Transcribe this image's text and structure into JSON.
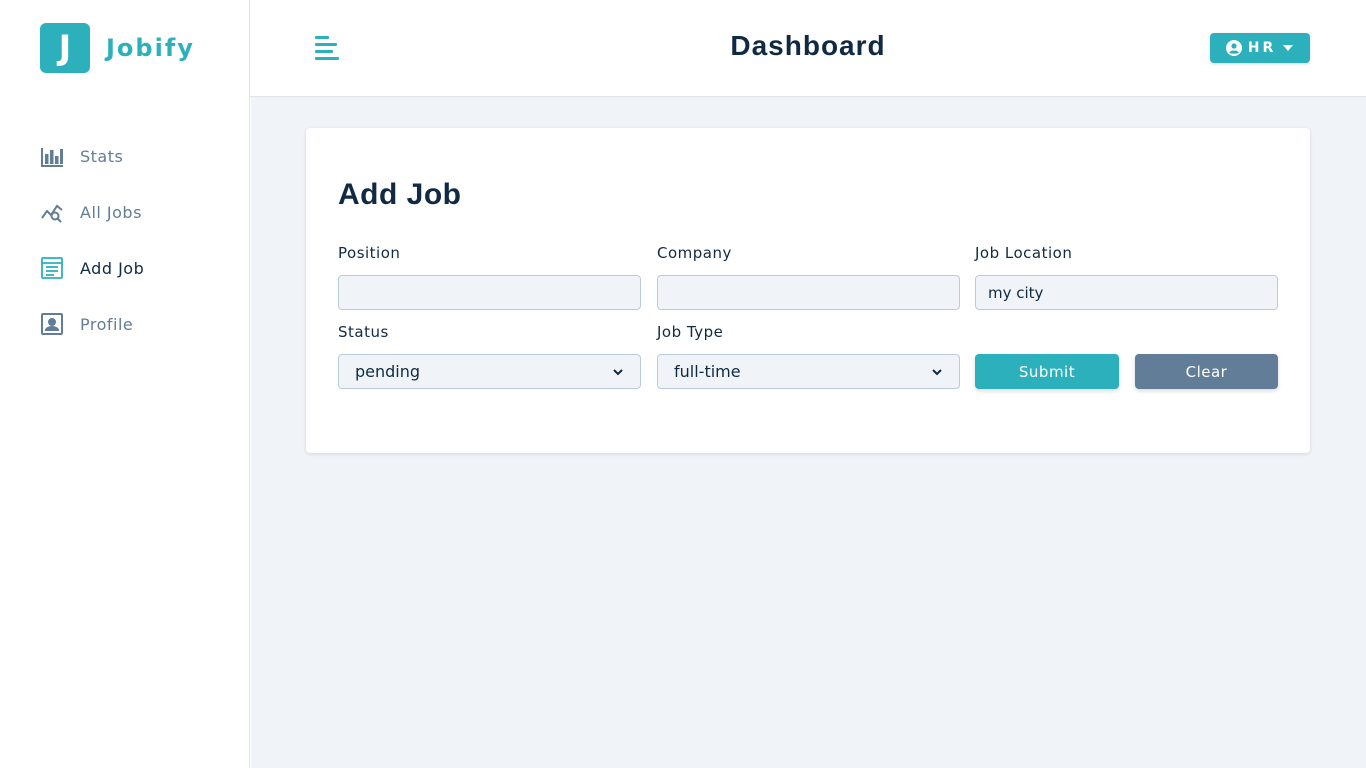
{
  "brand": {
    "logo_letter": "J",
    "name": "Jobify",
    "accent": "#2cb1bc"
  },
  "sidebar": {
    "items": [
      {
        "label": "Stats",
        "icon": "bar-chart-icon",
        "active": false
      },
      {
        "label": "All Jobs",
        "icon": "query-stats-icon",
        "active": false
      },
      {
        "label": "Add Job",
        "icon": "form-icon",
        "active": true
      },
      {
        "label": "Profile",
        "icon": "profile-card-icon",
        "active": false
      }
    ]
  },
  "header": {
    "title": "Dashboard",
    "toggle_icon": "menu-toggle-icon",
    "user_label": "HR",
    "user_icon": "user-circle-icon",
    "caret_icon": "caret-down-icon"
  },
  "form": {
    "title": "Add Job",
    "position": {
      "label": "Position",
      "value": ""
    },
    "company": {
      "label": "Company",
      "value": ""
    },
    "job_location": {
      "label": "Job Location",
      "value": "my city"
    },
    "status": {
      "label": "Status",
      "value": "pending"
    },
    "job_type": {
      "label": "Job Type",
      "value": "full-time"
    },
    "submit_label": "Submit",
    "clear_label": "Clear"
  },
  "colors": {
    "primary": "#2cb1bc",
    "secondary": "#627d98",
    "background": "#f0f4f8",
    "text": "#102a43"
  }
}
